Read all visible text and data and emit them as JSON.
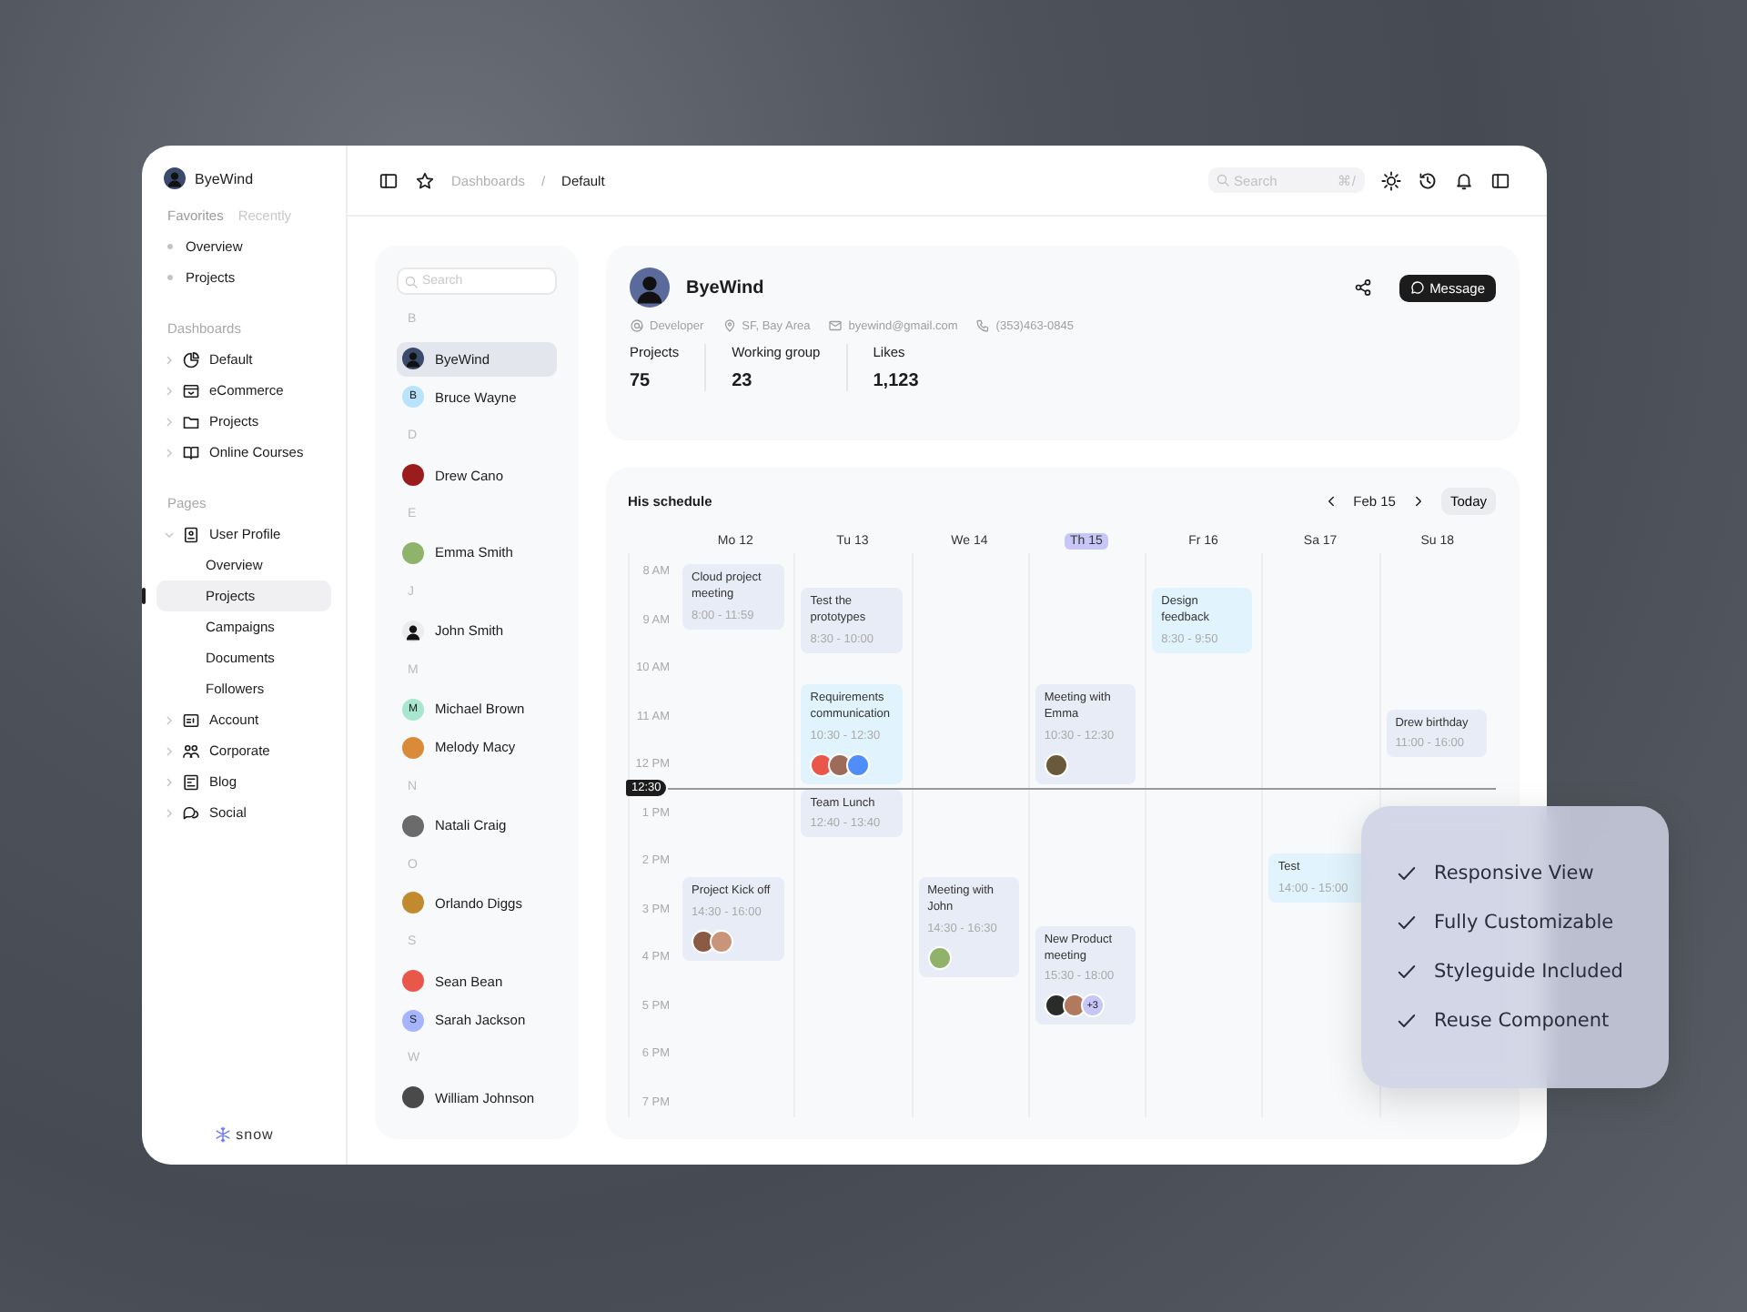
{
  "sidebar": {
    "user": "ByeWind",
    "tabs": [
      {
        "label": "Favorites",
        "selected": true
      },
      {
        "label": "Recently",
        "selected": false
      }
    ],
    "favorites": [
      "Overview",
      "Projects"
    ],
    "sections": [
      {
        "title": "Dashboards",
        "items": [
          {
            "label": "Default",
            "expanded": false
          },
          {
            "label": "eCommerce",
            "expanded": false
          },
          {
            "label": "Projects",
            "expanded": false
          },
          {
            "label": "Online Courses",
            "expanded": false
          }
        ]
      },
      {
        "title": "Pages",
        "items": [
          {
            "label": "User Profile",
            "expanded": true,
            "children": [
              {
                "label": "Overview",
                "selected": false
              },
              {
                "label": "Projects",
                "selected": true
              },
              {
                "label": "Campaigns",
                "selected": false
              },
              {
                "label": "Documents",
                "selected": false
              },
              {
                "label": "Followers",
                "selected": false
              }
            ]
          },
          {
            "label": "Account",
            "expanded": false
          },
          {
            "label": "Corporate",
            "expanded": false
          },
          {
            "label": "Blog",
            "expanded": false
          },
          {
            "label": "Social",
            "expanded": false
          }
        ]
      }
    ],
    "footer": "snow"
  },
  "topbar": {
    "breadcrumb": [
      "Dashboards",
      "Default"
    ],
    "separator": "/",
    "search": {
      "placeholder": "Search",
      "shortcut": "⌘/"
    }
  },
  "contacts": {
    "search": {
      "placeholder": "Search"
    },
    "groups": [
      {
        "letter": "B",
        "contacts": [
          {
            "name": "ByeWind",
            "selected": true,
            "avatar": {
              "kind": "silhouette",
              "color": "#3b4a6b"
            }
          },
          {
            "name": "Bruce Wayne",
            "selected": false,
            "avatar": {
              "kind": "letter",
              "letter": "B",
              "color": "#b9e3fb"
            }
          }
        ]
      },
      {
        "letter": "D",
        "contacts": [
          {
            "name": "Drew Cano",
            "selected": false,
            "avatar": {
              "kind": "photo",
              "color": "#9b1c1c"
            }
          }
        ]
      },
      {
        "letter": "E",
        "contacts": [
          {
            "name": "Emma Smith",
            "selected": false,
            "avatar": {
              "kind": "photo",
              "color": "#8fb36a"
            }
          }
        ]
      },
      {
        "letter": "J",
        "contacts": [
          {
            "name": "John Smith",
            "selected": false,
            "avatar": {
              "kind": "silhouette",
              "color": "#ececef"
            }
          }
        ]
      },
      {
        "letter": "M",
        "contacts": [
          {
            "name": "Michael Brown",
            "selected": false,
            "avatar": {
              "kind": "letter",
              "letter": "M",
              "color": "#a8e6cf"
            }
          },
          {
            "name": "Melody Macy",
            "selected": false,
            "avatar": {
              "kind": "photo",
              "color": "#d98b3a"
            }
          }
        ]
      },
      {
        "letter": "N",
        "contacts": [
          {
            "name": "Natali Craig",
            "selected": false,
            "avatar": {
              "kind": "photo",
              "color": "#6b6b6b"
            }
          }
        ]
      },
      {
        "letter": "O",
        "contacts": [
          {
            "name": "Orlando Diggs",
            "selected": false,
            "avatar": {
              "kind": "photo",
              "color": "#c28a2e"
            }
          }
        ]
      },
      {
        "letter": "S",
        "contacts": [
          {
            "name": "Sean Bean",
            "selected": false,
            "avatar": {
              "kind": "photo",
              "color": "#e8574a"
            }
          },
          {
            "name": "Sarah Jackson",
            "selected": false,
            "avatar": {
              "kind": "letter",
              "letter": "S",
              "color": "#a5b4fc"
            }
          }
        ]
      },
      {
        "letter": "W",
        "contacts": [
          {
            "name": "William Johnson",
            "selected": false,
            "avatar": {
              "kind": "photo",
              "color": "#4a4a4a"
            }
          }
        ]
      }
    ]
  },
  "profile": {
    "name": "ByeWind",
    "button": "Message",
    "info": [
      {
        "kind": "role",
        "text": "Developer"
      },
      {
        "kind": "location",
        "text": "SF, Bay Area"
      },
      {
        "kind": "email",
        "text": "byewind@gmail.com"
      },
      {
        "kind": "phone",
        "text": "(353)463-0845"
      }
    ],
    "stats": [
      {
        "label": "Projects",
        "value": "75"
      },
      {
        "label": "Working group",
        "value": "23"
      },
      {
        "label": "Likes",
        "value": "1,123"
      }
    ]
  },
  "schedule": {
    "title": "His schedule",
    "date": "Feb 15",
    "today": "Today",
    "now": "12:30",
    "hours": [
      "8 AM",
      "9 AM",
      "10 AM",
      "11 AM",
      "12 PM",
      "1 PM",
      "2 PM",
      "3 PM",
      "4 PM",
      "5 PM",
      "6 PM",
      "7 PM"
    ],
    "days": [
      {
        "label": "Mo 12",
        "selected": false,
        "events": [
          {
            "title": "Cloud project meeting",
            "time": "8:00 - 11:59",
            "color": "#e8ecf6"
          },
          {
            "title": "Project Kick off",
            "time": "14:30 - 16:00",
            "color": "#e8ecf6",
            "avatars": [
              {
                "color": "#8a5a44"
              },
              {
                "color": "#c9957a"
              }
            ]
          }
        ]
      },
      {
        "label": "Tu 13",
        "selected": false,
        "events": [
          {
            "title": "Test the prototypes",
            "time": "8:30 - 10:00",
            "color": "#e8ecf6"
          },
          {
            "title": "Requirements communication",
            "time": "10:30 - 12:30",
            "color": "#e1f4fd",
            "avatars": [
              {
                "color": "#e8574a"
              },
              {
                "color": "#9c6b5a"
              },
              {
                "color": "#4f8ef7"
              }
            ]
          },
          {
            "title": "Team Lunch",
            "time": "12:40 - 13:40",
            "color": "#e8ecf6"
          }
        ]
      },
      {
        "label": "We 14",
        "selected": false,
        "events": [
          {
            "title": "Meeting with John",
            "time": "14:30 - 16:30",
            "color": "#e8ecf6",
            "avatars": [
              {
                "color": "#8fb36a"
              }
            ]
          }
        ]
      },
      {
        "label": "Th 15",
        "selected": true,
        "events": [
          {
            "title": "Meeting with Emma",
            "time": "10:30 - 12:30",
            "color": "#e8ecf6",
            "avatars": [
              {
                "color": "#6b5a3a"
              }
            ]
          },
          {
            "title": "New Product meeting",
            "time": "15:30 - 18:00",
            "color": "#e8ecf6",
            "avatars": [
              {
                "color": "#2b2b2b"
              },
              {
                "color": "#b07a5e"
              }
            ],
            "more": "+3"
          }
        ]
      },
      {
        "label": "Fr 16",
        "selected": false,
        "events": [
          {
            "title": "Design feedback",
            "time": "8:30 - 9:50",
            "color": "#e1f4fd"
          }
        ]
      },
      {
        "label": "Sa 17",
        "selected": false,
        "events": [
          {
            "title": "Test",
            "time": "14:00 - 15:00",
            "color": "#e1f4fd"
          }
        ]
      },
      {
        "label": "Su 18",
        "selected": false,
        "events": [
          {
            "title": "Drew birthday",
            "time": "11:00 - 16:00",
            "color": "#e8ecf6"
          }
        ]
      }
    ]
  },
  "features": [
    "Responsive View",
    "Fully Customizable",
    "Styleguide Included",
    "Reuse Component"
  ]
}
